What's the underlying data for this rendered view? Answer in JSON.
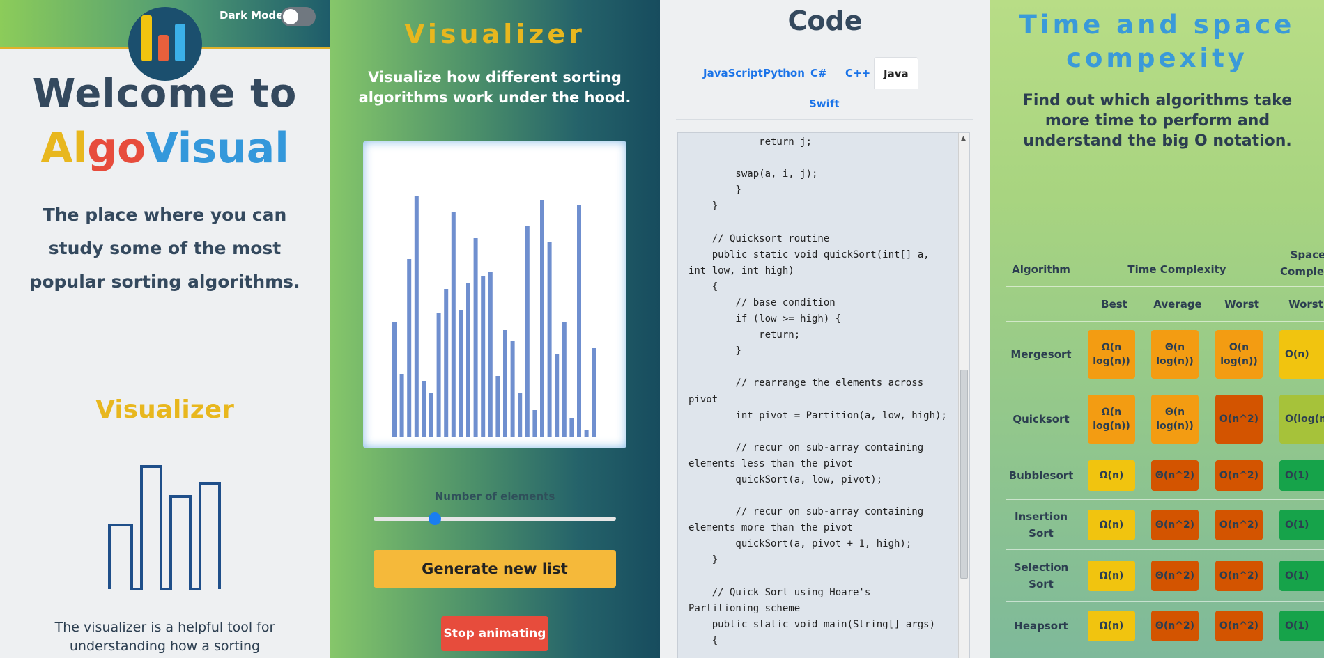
{
  "p1": {
    "dark_mode_label": "Dark Mode",
    "welcome": "Welcome to",
    "brand": {
      "al": "Al",
      "go": "go",
      "visual": "Visual"
    },
    "tagline": "The place where you can study some of the most popular sorting algorithms.",
    "section_title": "Visualizer",
    "description": "The visualizer is a helpful tool for understanding how a sorting"
  },
  "p2": {
    "title": "Visualizer",
    "subtitle": "Visualize how different sorting algorithms work under the hood.",
    "num_label": "Number of elements",
    "slider_value": 0.24,
    "generate_label": "Generate new list",
    "stop_label": "Stop animating",
    "bars": [
      165,
      90,
      255,
      345,
      80,
      62,
      178,
      212,
      322,
      182,
      220,
      285,
      230,
      236,
      87,
      153,
      137,
      62,
      303,
      38,
      340,
      280,
      118,
      165,
      27,
      332,
      10,
      127
    ],
    "bar_color": "#6f8fcf"
  },
  "p3": {
    "title": "Code",
    "tabs": [
      "JavaScript",
      "Python",
      "C#",
      "C++",
      "Java",
      "Swift"
    ],
    "active_tab": "Java",
    "code": "            return j;\n\n        swap(a, i, j);\n        }\n    }\n\n    // Quicksort routine\n    public static void quickSort(int[] a,\nint low, int high)\n    {\n        // base condition\n        if (low >= high) {\n            return;\n        }\n\n        // rearrange the elements across\npivot\n        int pivot = Partition(a, low, high);\n\n        // recur on sub-array containing\nelements less than the pivot\n        quickSort(a, low, pivot);\n\n        // recur on sub-array containing\nelements more than the pivot\n        quickSort(a, pivot + 1, high);\n    }\n\n    // Quick Sort using Hoare's\nPartitioning scheme\n    public static void main(String[] args)\n    {"
  },
  "p4": {
    "title": "Time and space compexity",
    "subtitle": "Find out which algorithms take more time to perform and understand the big O notation.",
    "headers": {
      "algorithm": "Algorithm",
      "time": "Time Complexity",
      "space": "Space Complexity",
      "best": "Best",
      "average": "Average",
      "worst": "Worst",
      "space_worst": "Worst"
    },
    "colors": {
      "orange": "#f39c12",
      "dark_orange": "#d35400",
      "yellow": "#f1c40f",
      "lime": "#a6c23a",
      "green": "#16a34a"
    },
    "rows": [
      {
        "name": "Mergesort",
        "best": "Ω(n log(n))",
        "average": "Θ(n log(n))",
        "worst": "O(n log(n))",
        "space": "O(n)"
      },
      {
        "name": "Quicksort",
        "best": "Ω(n log(n))",
        "average": "Θ(n log(n))",
        "worst": "O(n^2)",
        "space": "O(log(n))"
      },
      {
        "name": "Bubblesort",
        "best": "Ω(n)",
        "average": "Θ(n^2)",
        "worst": "O(n^2)",
        "space": "O(1)"
      },
      {
        "name": "Insertion Sort",
        "best": "Ω(n)",
        "average": "Θ(n^2)",
        "worst": "O(n^2)",
        "space": "O(1)"
      },
      {
        "name": "Selection Sort",
        "best": "Ω(n)",
        "average": "Θ(n^2)",
        "worst": "O(n^2)",
        "space": "O(1)"
      },
      {
        "name": "Heapsort",
        "best": "Ω(n)",
        "average": "Θ(n^2)",
        "worst": "O(n^2)",
        "space": "O(1)"
      }
    ]
  }
}
